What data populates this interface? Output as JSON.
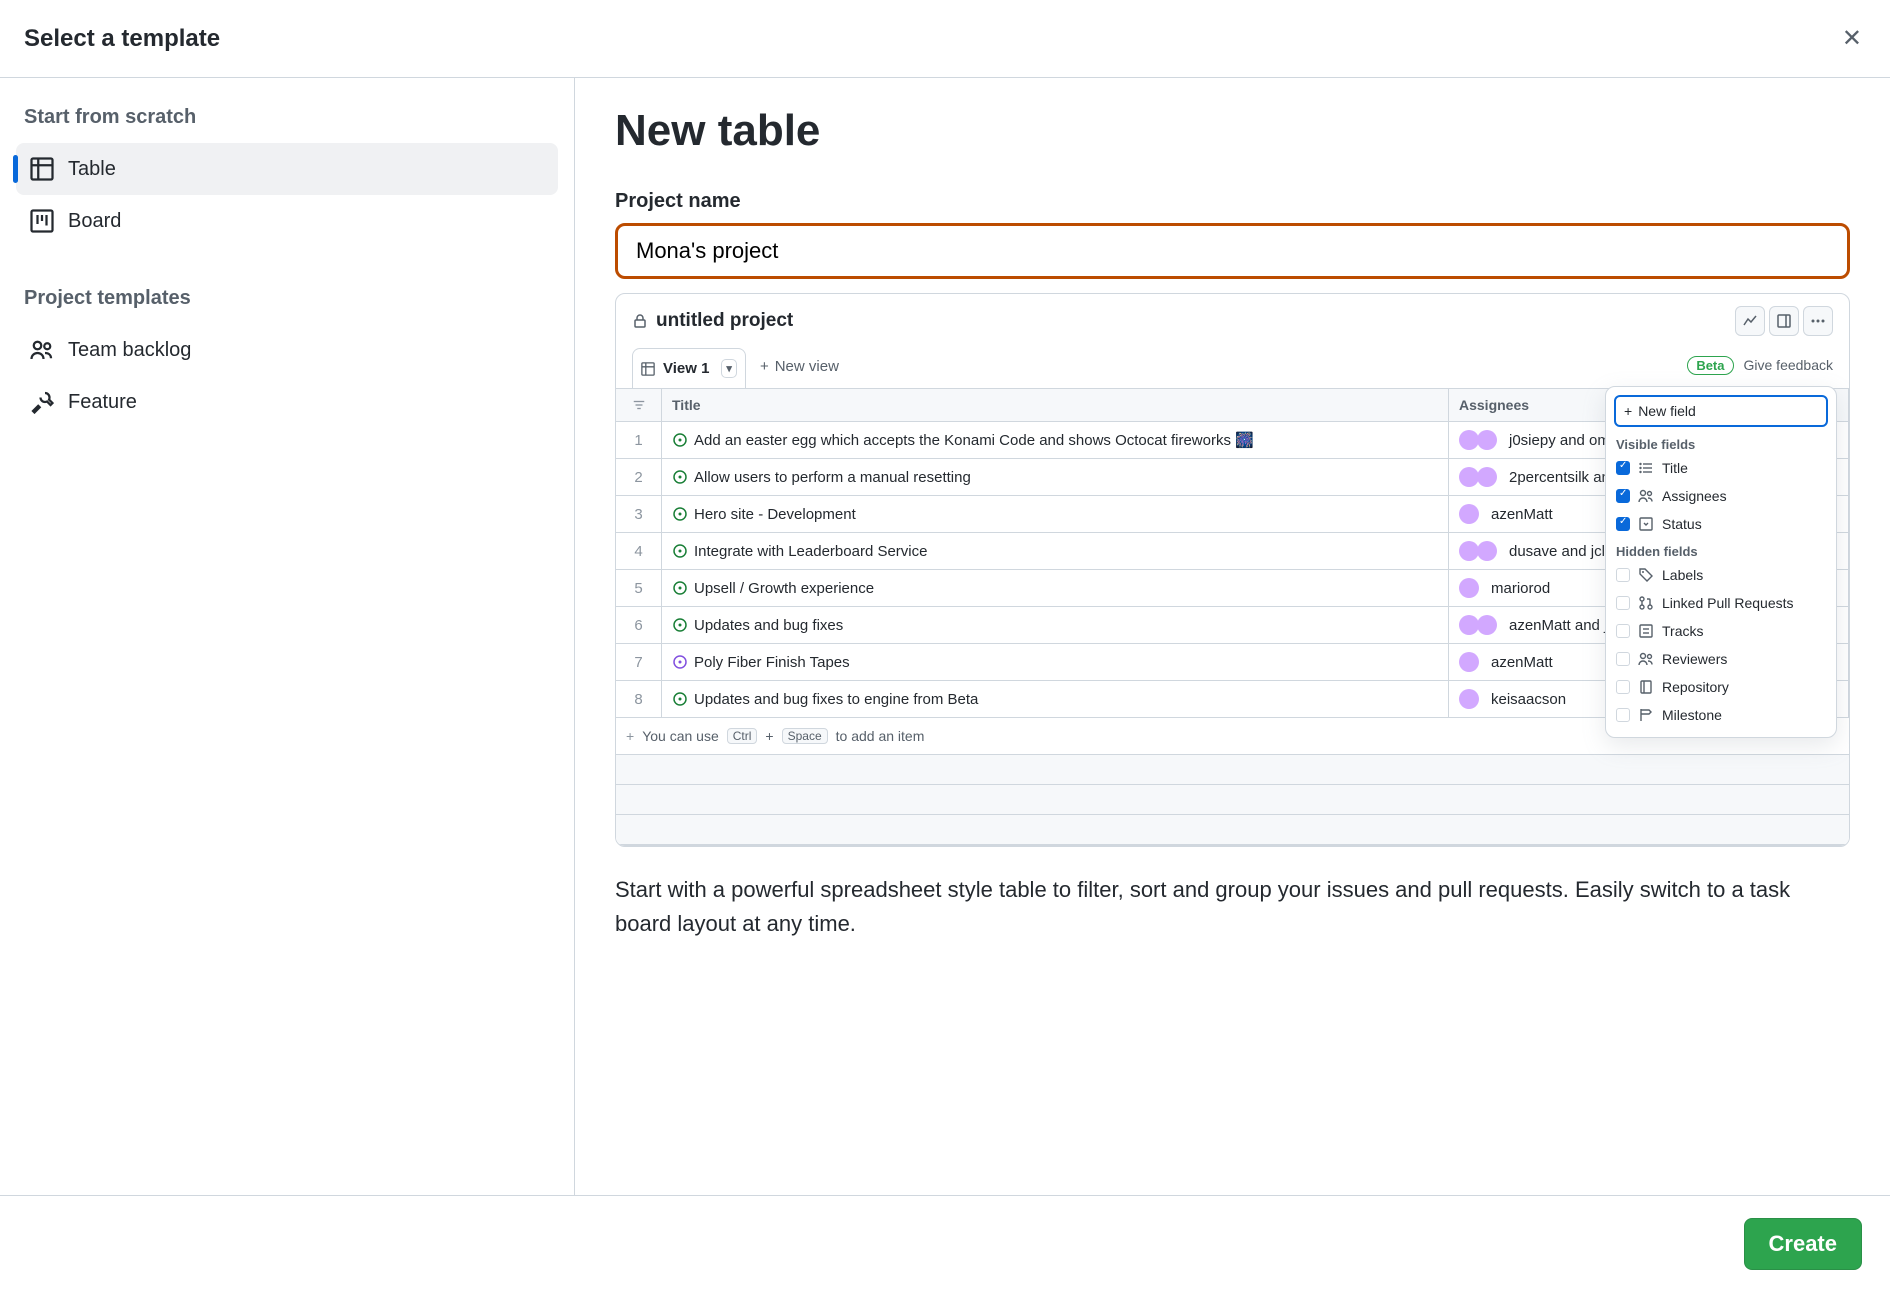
{
  "header": {
    "title": "Select a template"
  },
  "sidebar": {
    "section1_title": "Start from scratch",
    "section2_title": "Project templates",
    "table_label": "Table",
    "board_label": "Board",
    "team_backlog_label": "Team backlog",
    "feature_label": "Feature"
  },
  "main": {
    "heading": "New table",
    "project_name_label": "Project name",
    "project_name_value": "Mona's project",
    "description": "Start with a powerful spreadsheet style table to filter, sort and group your issues and pull requests. Easily switch to a task board layout at any time."
  },
  "preview": {
    "project_title": "untitled project",
    "view_label": "View 1",
    "new_view_label": "New view",
    "beta_label": "Beta",
    "feedback_label": "Give feedback",
    "columns": {
      "title": "Title",
      "assignees": "Assignees",
      "status": "Status"
    },
    "rows": [
      {
        "n": "1",
        "icon": "open",
        "title": "Add an easter egg which accepts the Konami Code and shows Octocat fireworks 🎆",
        "assignees": "j0siepy and omer",
        "avatars": 2
      },
      {
        "n": "2",
        "icon": "open",
        "title": "Allow users to perform a manual resetting",
        "assignees": "2percentsilk and",
        "avatars": 2
      },
      {
        "n": "3",
        "icon": "open",
        "title": "Hero site - Development",
        "assignees": "azenMatt",
        "avatars": 1
      },
      {
        "n": "4",
        "icon": "open",
        "title": "Integrate with Leaderboard Service",
        "assignees": "dusave and jclem",
        "avatars": 2
      },
      {
        "n": "5",
        "icon": "open",
        "title": "Upsell / Growth experience",
        "assignees": "mariorod",
        "avatars": 1
      },
      {
        "n": "6",
        "icon": "open",
        "title": "Updates and bug fixes",
        "assignees": "azenMatt and j0s",
        "avatars": 2
      },
      {
        "n": "7",
        "icon": "closed",
        "title": "Poly Fiber Finish Tapes",
        "assignees": "azenMatt",
        "avatars": 1
      },
      {
        "n": "8",
        "icon": "open",
        "title": "Updates and bug fixes to engine from Beta",
        "assignees": "keisaacson",
        "avatars": 1
      }
    ],
    "add_row": {
      "prefix": "You can use",
      "k1": "Ctrl",
      "plus": "+",
      "k2": "Space",
      "suffix": "to add an item"
    }
  },
  "popover": {
    "new_field": "New field",
    "visible_title": "Visible fields",
    "hidden_title": "Hidden fields",
    "visible": [
      {
        "label": "Title",
        "icon": "list"
      },
      {
        "label": "Assignees",
        "icon": "people"
      },
      {
        "label": "Status",
        "icon": "select"
      }
    ],
    "hidden": [
      {
        "label": "Labels",
        "icon": "tag"
      },
      {
        "label": "Linked Pull Requests",
        "icon": "pr"
      },
      {
        "label": "Tracks",
        "icon": "tracks"
      },
      {
        "label": "Reviewers",
        "icon": "people"
      },
      {
        "label": "Repository",
        "icon": "repo"
      },
      {
        "label": "Milestone",
        "icon": "milestone"
      }
    ]
  },
  "footer": {
    "create": "Create"
  }
}
